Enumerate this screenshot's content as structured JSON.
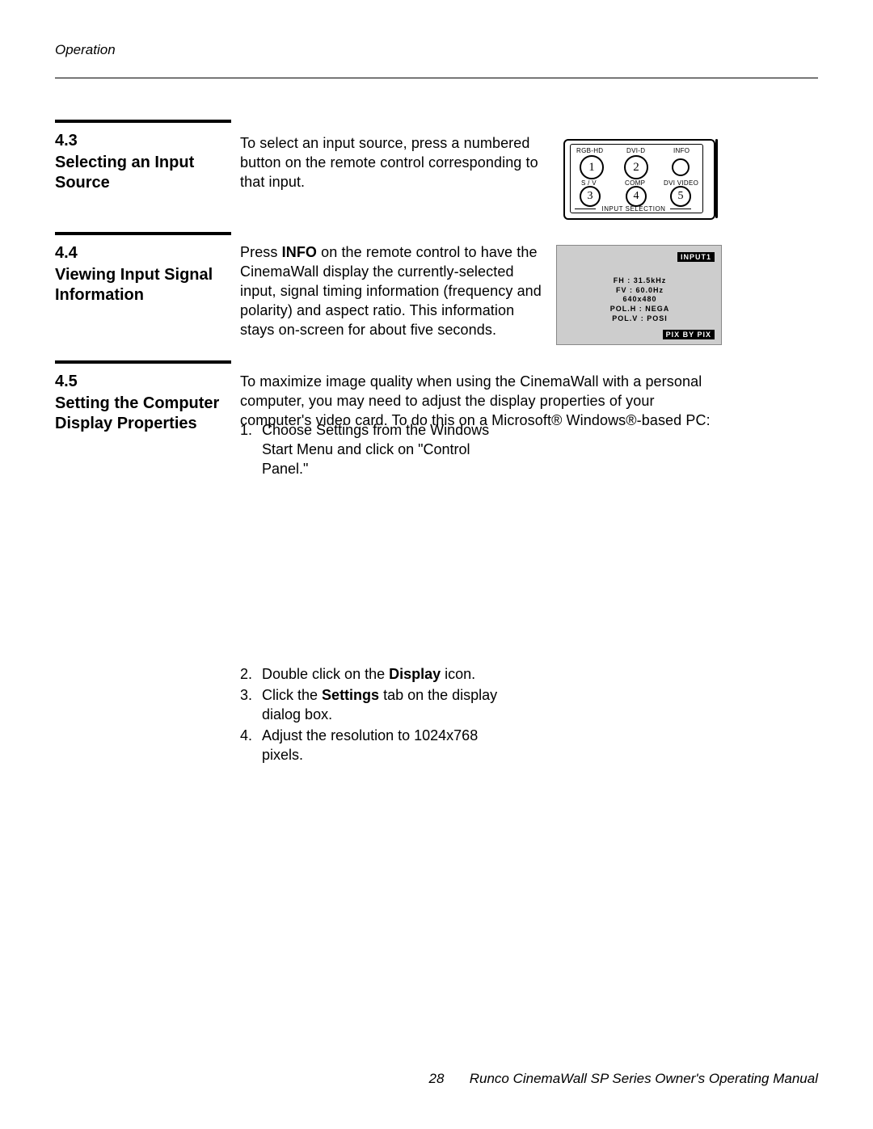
{
  "header": {
    "section_name": "Operation"
  },
  "sections": {
    "s43": {
      "number": "4.3",
      "title": "Selecting an Input Source",
      "body": "To select an input source, press a numbered button on the remote control corresponding to that input."
    },
    "s44": {
      "number": "4.4",
      "title": "Viewing Input Signal Information",
      "body_pre": "Press ",
      "body_bold": "INFO",
      "body_post": " on the remote control to have the CinemaWall display the currently-selected input, signal timing information (frequency and polarity) and aspect ratio. This information stays on-screen for about five seconds."
    },
    "s45": {
      "number": "4.5",
      "title": "Setting the Computer Display Properties",
      "body": "To maximize image quality when using the CinemaWall with a personal computer, you may need to adjust the display properties of your computer's video card. To do this on a Microsoft® Windows®-based PC:",
      "steps": {
        "1": {
          "num": "1.",
          "text": "Choose Settings from the Windows Start Menu and click on \"Control Panel.\""
        },
        "2": {
          "num": "2.",
          "text_pre": "Double click on the ",
          "text_bold": "Display",
          "text_post": " icon."
        },
        "3": {
          "num": "3.",
          "text_pre": "Click the ",
          "text_bold": "Settings",
          "text_post": " tab on the display dialog box."
        },
        "4": {
          "num": "4.",
          "text": "Adjust the resolution to 1024x768 pixels."
        }
      }
    }
  },
  "remote": {
    "labels": {
      "rgbhd": "RGB-HD",
      "dvid": "DVI-D",
      "info": "INFO",
      "sv": "S / V",
      "comp": "COMP",
      "dvivideo": "DVI VIDEO",
      "footer": "INPUT SELECTION"
    },
    "buttons": {
      "b1": "1",
      "b2": "2",
      "b3": "3",
      "b4": "4",
      "b5": "5"
    }
  },
  "osd": {
    "top_badge": "INPUT1",
    "bottom_badge": "PIX BY PIX",
    "lines": {
      "l1": "FH : 31.5kHz",
      "l2": "FV : 60.0Hz",
      "l3": "640x480",
      "l4": "POL.H : NEGA",
      "l5": "POL.V : POSI"
    }
  },
  "footer": {
    "page": "28",
    "manual": "Runco CinemaWall SP Series Owner's Operating Manual"
  }
}
